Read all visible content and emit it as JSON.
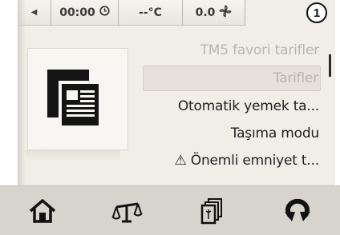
{
  "statusbar": {
    "back_icon": "left-arrow-icon",
    "time": "00:00",
    "time_icon": "clock-icon",
    "temperature": "--°C",
    "speed": "0.0",
    "speed_icon": "fan-icon",
    "callout_number": "1"
  },
  "card": {
    "icon": "recipe-cards-icon"
  },
  "menu": {
    "items": [
      {
        "label": "TM5 favori tarifler",
        "state": "faded"
      },
      {
        "label": "Tarifler",
        "state": "selected"
      },
      {
        "label": "Otomatik yemek ta...",
        "state": "normal"
      },
      {
        "label": "Taşıma modu",
        "state": "normal"
      },
      {
        "label": "⚠ Önemli emniyet t...",
        "state": "normal"
      }
    ]
  },
  "bottombar": {
    "buttons": [
      "home-icon",
      "scale-icon",
      "recipe-book-icon",
      "turbo-icon"
    ]
  },
  "colors": {
    "display_bg": "#f1eee8",
    "bottom_bg": "#d7d4ce",
    "text": "#1f1f1f",
    "faded_text": "#b9b5ae"
  }
}
